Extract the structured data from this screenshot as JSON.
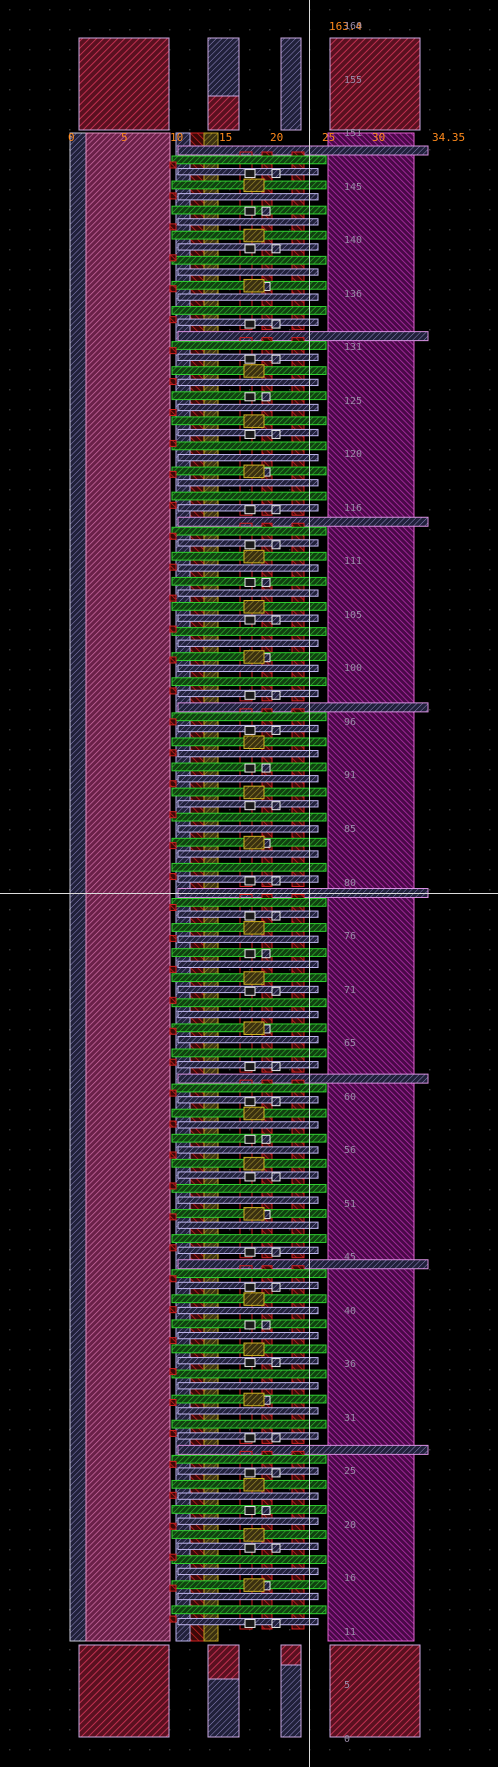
{
  "viewer": {
    "top_coordinate": "163.4",
    "right_coordinate": "34.35"
  },
  "x_ruler_labels": [
    "0",
    "5",
    "10",
    "15",
    "20",
    "25",
    "30"
  ],
  "y_ruler_labels": [
    "160",
    "155",
    "151",
    "145",
    "140",
    "136",
    "131",
    "125",
    "120",
    "116",
    "111",
    "105",
    "100",
    "96",
    "91",
    "85",
    "80",
    "76",
    "71",
    "65",
    "60",
    "56",
    "51",
    "45",
    "40",
    "36",
    "31",
    "25",
    "20",
    "16",
    "11",
    "5",
    "0"
  ],
  "colors": {
    "background": "#000000",
    "grid_dot": "#3a3a3a",
    "crosshair": "#dcdcdc",
    "ruler_text": "#ff8a1c",
    "metal_red": "#d02020",
    "diffusion_green": "#20c020",
    "metal_pink": "#d070b0",
    "metal_purple": "#a02090",
    "poly_lavender": "#b8b0e8",
    "via_white": "#e8e8e8",
    "contact_gray": "#8a8a8a"
  },
  "layout": {
    "cells": 8,
    "rows_per_cell": 14
  }
}
